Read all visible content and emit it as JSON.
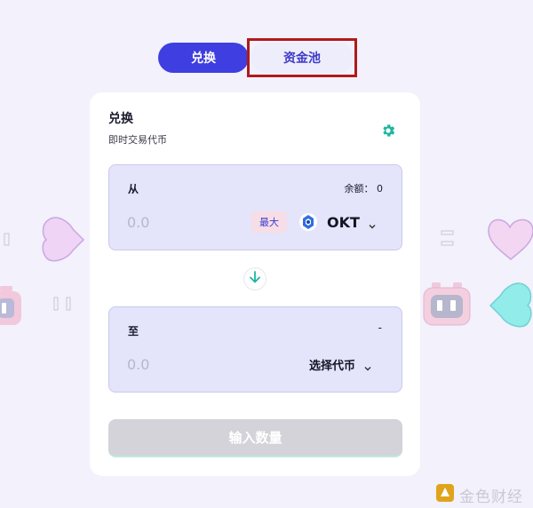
{
  "tabs": [
    {
      "label": "兑换",
      "active": true
    },
    {
      "label": "资金池",
      "active": false
    }
  ],
  "card": {
    "title": "兑换",
    "subtitle": "即时交易代币",
    "settings_icon": "gear-icon"
  },
  "from": {
    "label": "从",
    "balance": "余额： 0",
    "amount_placeholder": "0.0",
    "max_label": "最大",
    "token": "OKT"
  },
  "to": {
    "label": "至",
    "balance": "-",
    "amount_placeholder": "0.0",
    "token": "选择代币"
  },
  "submit_label": "输入数量",
  "watermark": "金色财经",
  "colors": {
    "accent": "#3f3ee0",
    "teal": "#1fb5a0",
    "background": "#f2f1fc",
    "highlight_box": "#b11a1a"
  }
}
